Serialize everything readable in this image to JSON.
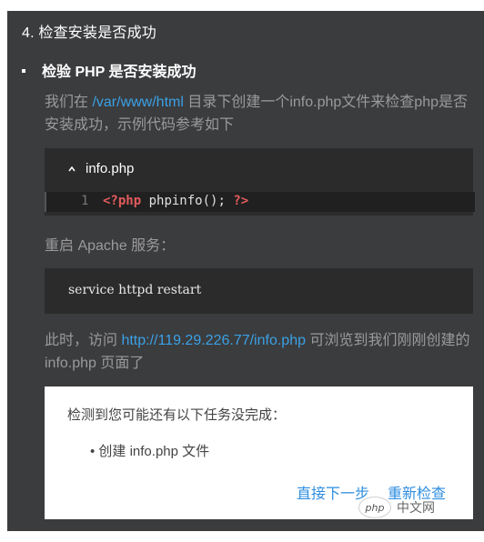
{
  "step": {
    "title": "4. 检查安装是否成功"
  },
  "section": {
    "bullet_label": "检验 PHP 是否安装成功"
  },
  "para1": {
    "pre": "我们在 ",
    "link": "/var/www/html",
    "post": " 目录下创建一个info.php文件来检查php是否安装成功，示例代码参考如下"
  },
  "code_block": {
    "filename": "info.php",
    "line_number": "1",
    "open_tag": "<?php",
    "body": " phpinfo(); ",
    "close_tag": "?>"
  },
  "para2": {
    "text": "重启 Apache 服务："
  },
  "command_block": {
    "text": "service httpd restart"
  },
  "para3": {
    "pre": "此时，访问 ",
    "link": "http://119.29.226.77/info.php",
    "post": " 可浏览到我们刚刚创建的 info.php 页面了"
  },
  "task_card": {
    "title": "检测到您可能还有以下任务没完成：",
    "item": "• 创建 info.php 文件",
    "next_button": "直接下一步",
    "recheck_button": "重新检查"
  },
  "watermark": {
    "logo": "php",
    "text": "中文网"
  },
  "colors": {
    "panel": "#3b3c3e",
    "link": "#3aa1e6",
    "php_tag": "#e35b5b",
    "button": "#2f8ee0"
  }
}
